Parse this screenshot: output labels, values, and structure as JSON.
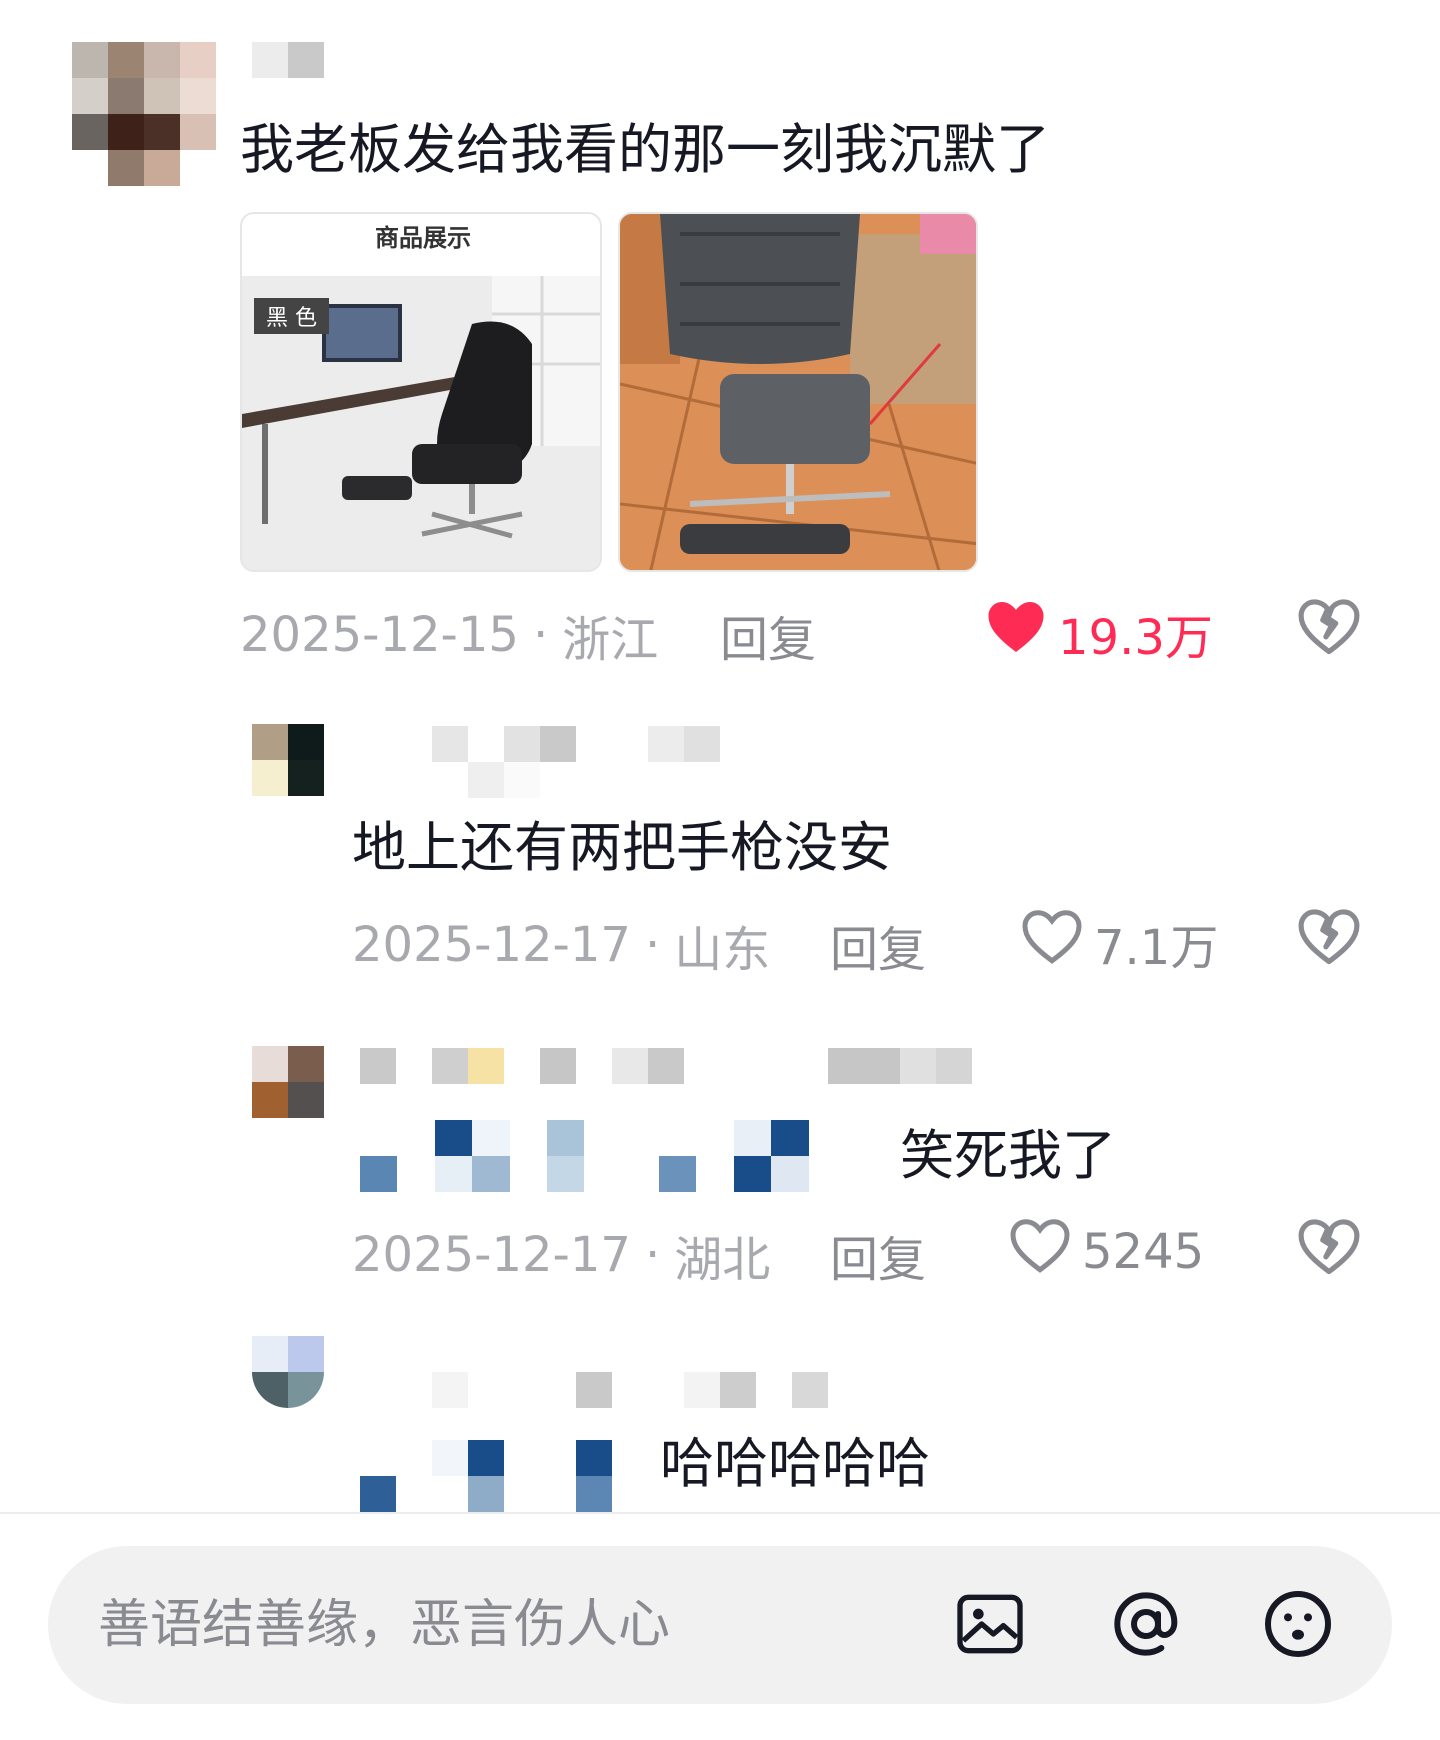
{
  "comments": [
    {
      "text": "我老板发给我看的那一刻我沉默了",
      "date": "2025-12-15",
      "sep": "·",
      "region": "浙江",
      "reply_label": "回复",
      "likes": "19.3万",
      "liked": true,
      "images": [
        {
          "caption": "商品展示",
          "tag": "黑 色"
        },
        {}
      ]
    },
    {
      "text": "地上还有两把手枪没安",
      "date": "2025-12-17",
      "sep": "·",
      "region": "山东",
      "reply_label": "回复",
      "likes": "7.1万",
      "liked": false
    },
    {
      "text": "笑死我了",
      "date": "2025-12-17",
      "sep": "·",
      "region": "湖北",
      "reply_label": "回复",
      "likes": "5245",
      "liked": false
    },
    {
      "text": "哈哈哈哈哈"
    }
  ],
  "input": {
    "placeholder": "善语结善缘，恶言伤人心"
  },
  "colors": {
    "like_active": "#fe2c55",
    "meta_text": "#a8a9ae",
    "input_bg": "#f1f1f2"
  },
  "icons": [
    "heart-filled-icon",
    "heart-outline-icon",
    "dislike-icon",
    "image-icon",
    "at-icon",
    "emoji-icon"
  ]
}
